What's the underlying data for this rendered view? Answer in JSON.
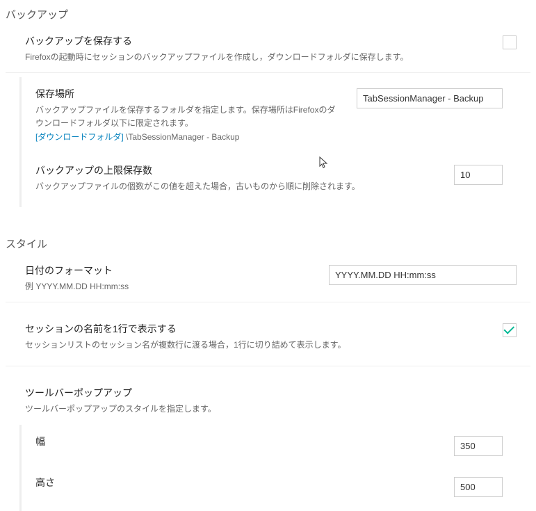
{
  "backup": {
    "section_title": "バックアップ",
    "save": {
      "title": "バックアップを保存する",
      "desc": "Firefoxの起動時にセッションのバックアップファイルを作成し，ダウンロードフォルダに保存します。",
      "checked": false
    },
    "location": {
      "title": "保存場所",
      "desc1": "バックアップファイルを保存するフォルダを指定します。保存場所はFirefoxのダウンロードフォルダ以下に限定されます。",
      "link_text": "[ダウンロードフォルダ]",
      "suffix": " \\TabSessionManager - Backup",
      "value": "TabSessionManager - Backup"
    },
    "limit": {
      "title": "バックアップの上限保存数",
      "desc": "バックアップファイルの個数がこの値を超えた場合，古いものから順に削除されます。",
      "value": "10"
    }
  },
  "style": {
    "section_title": "スタイル",
    "date_format": {
      "title": "日付のフォーマット",
      "desc": "例 YYYY.MM.DD HH:mm:ss",
      "value": "YYYY.MM.DD HH:mm:ss"
    },
    "single_line": {
      "title": "セッションの名前を1行で表示する",
      "desc": "セッションリストのセッション名が複数行に渡る場合，1行に切り詰めて表示します。",
      "checked": true
    },
    "toolbar_popup": {
      "title": "ツールバーポップアップ",
      "desc": "ツールバーポップアップのスタイルを指定します。",
      "width_label": "幅",
      "width_value": "350",
      "height_label": "高さ",
      "height_value": "500"
    }
  }
}
